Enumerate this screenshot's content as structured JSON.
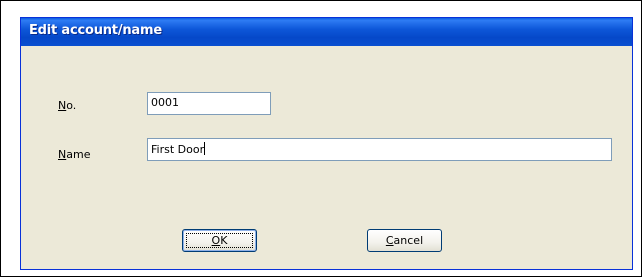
{
  "dialog": {
    "title": "Edit account/name"
  },
  "fields": {
    "number": {
      "label_accel": "N",
      "label_rest": "o.",
      "value": "0001"
    },
    "name": {
      "label_accel": "N",
      "label_rest": "ame",
      "value": "First Door"
    }
  },
  "buttons": {
    "ok": {
      "accel": "O",
      "rest": "K"
    },
    "cancel": {
      "accel": "C",
      "rest": "ancel"
    }
  },
  "colors": {
    "titlebar": "#0a4fd0",
    "dialog_bg": "#ece9d8",
    "textbox_border": "#7f9db9",
    "button_border": "#003c74"
  }
}
